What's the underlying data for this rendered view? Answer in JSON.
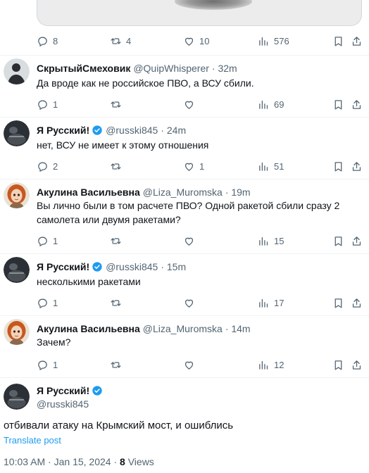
{
  "top_actions": {
    "replies": "8",
    "reposts": "4",
    "likes": "10",
    "views": "576"
  },
  "replies": [
    {
      "name": "СкрытыйСмеховик",
      "handle": "@QuipWhisperer",
      "time": "· 32m",
      "verified": false,
      "avatar": "dark-silhouette",
      "text": "Да вроде как не российское ПВО, а ВСУ сбили.",
      "stats": {
        "replies": "1",
        "reposts": "",
        "likes": "",
        "views": "69"
      }
    },
    {
      "name": "Я Русский!",
      "handle": "@russki845",
      "time": "· 24m",
      "verified": true,
      "avatar": "dark-circle",
      "text": "нет, ВСУ не имеет к этому отношения",
      "stats": {
        "replies": "2",
        "reposts": "",
        "likes": "1",
        "views": "51"
      }
    },
    {
      "name": "Акулина Васильевна",
      "handle": "@Liza_Muromska",
      "time": "· 19m",
      "verified": false,
      "avatar": "redhead-portrait",
      "text": "Вы лично были в том расчете ПВО?  Одной ракетой сбили сразу 2 самолета или двумя ракетами?",
      "stats": {
        "replies": "1",
        "reposts": "",
        "likes": "",
        "views": "15"
      }
    },
    {
      "name": "Я Русский!",
      "handle": "@russki845",
      "time": "· 15m",
      "verified": true,
      "avatar": "dark-circle",
      "text": "несколькими ракетами",
      "stats": {
        "replies": "1",
        "reposts": "",
        "likes": "",
        "views": "17"
      }
    },
    {
      "name": "Акулина Васильевна",
      "handle": "@Liza_Muromska",
      "time": "· 14m",
      "verified": false,
      "avatar": "redhead-portrait",
      "text": "Зачем?",
      "stats": {
        "replies": "1",
        "reposts": "",
        "likes": "",
        "views": "12"
      }
    }
  ],
  "main_tweet": {
    "name": "Я Русский!",
    "handle": "@russki845",
    "text": "отбивали атаку на Крымский мост, и ошиблись",
    "translate_label": "Translate post",
    "time": "10:03 AM",
    "date": "Jan 15, 2024",
    "separator": "·",
    "views_count": "8",
    "views_label": "Views"
  },
  "colors": {
    "verified": "#1d9bf0",
    "muted": "#536471",
    "link": "#1d9bf0",
    "divider": "#eff3f4"
  }
}
